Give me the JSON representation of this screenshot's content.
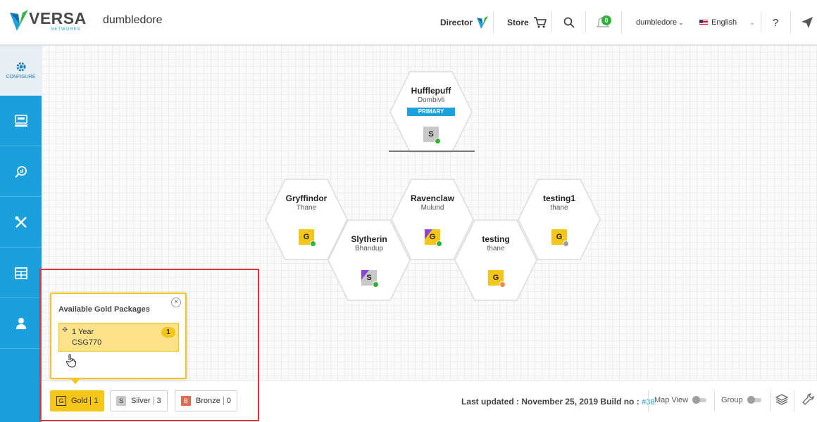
{
  "header": {
    "brand": "VERSA",
    "brand_sub": "NETWORKS",
    "site_title": "dumbledore",
    "director_label": "Director",
    "store_label": "Store",
    "notification_count": "0",
    "user_label": "dumbledore",
    "language_label": "English",
    "help_label": "?"
  },
  "sidebar": {
    "configure_label": "CONFIGURE"
  },
  "hexes": [
    {
      "name": "Hufflepuff",
      "location": "Dombivli",
      "tag": "PRIMARY",
      "badge": "S",
      "badge_type": "silver",
      "status": "green"
    },
    {
      "name": "Gryffindor",
      "location": "Thane",
      "badge": "G",
      "badge_type": "gold",
      "status": "green"
    },
    {
      "name": "Ravenclaw",
      "location": "Mulund",
      "badge": "G",
      "badge_type": "gold-purple",
      "status": "green"
    },
    {
      "name": "testing1",
      "location": "thane",
      "badge": "G",
      "badge_type": "gold",
      "status": "gray"
    },
    {
      "name": "Slytherin",
      "location": "Bhandup",
      "badge": "S",
      "badge_type": "silver-purple",
      "status": "green"
    },
    {
      "name": "testing",
      "location": "thane",
      "badge": "G",
      "badge_type": "gold",
      "status": "orange"
    }
  ],
  "popup": {
    "title": "Available Gold Packages",
    "item_term": "1 Year",
    "item_code": "CSG770",
    "item_count": "1"
  },
  "packages": [
    {
      "letter": "G",
      "label": "Gold",
      "count": "1"
    },
    {
      "letter": "S",
      "label": "Silver",
      "count": "3"
    },
    {
      "letter": "B",
      "label": "Bronze",
      "count": "0"
    }
  ],
  "footer": {
    "last_updated_text": "Last updated : November 25, 2019 Build no :",
    "build_no": "#38",
    "map_view_label": "Map View",
    "group_label": "Group"
  },
  "colors": {
    "accent": "#1aa0dc",
    "gold": "#f5c518",
    "silver": "#c8c8c8",
    "bronze": "#e06a4f",
    "status_green": "#2eb135",
    "status_orange": "#f08a4b",
    "status_gray": "#9e9e9e",
    "highlight": "#e0353b"
  }
}
